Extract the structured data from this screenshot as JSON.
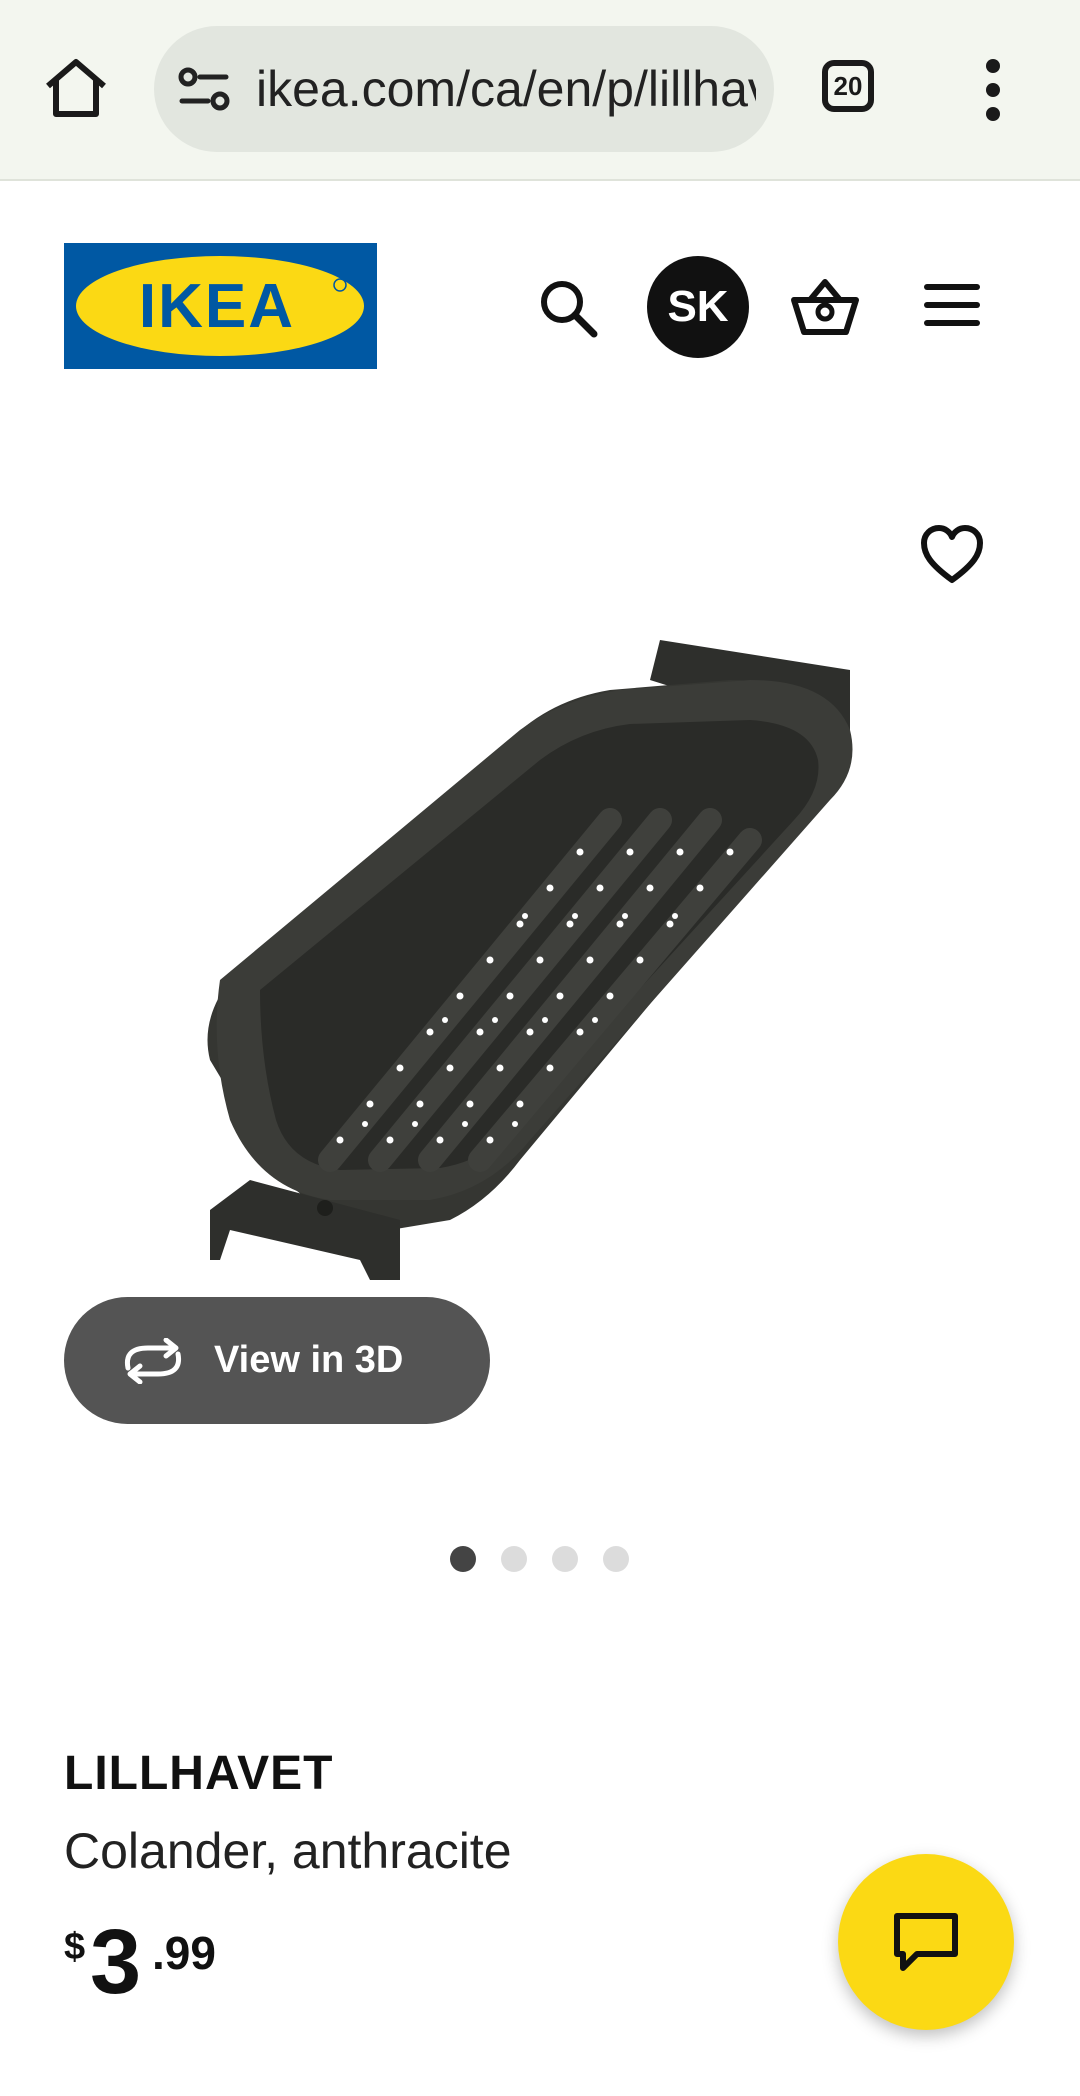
{
  "browser": {
    "url": "ikea.com/ca/en/p/lillhavet-colander-anthracite",
    "tab_count": "20",
    "icons": {
      "home": "home-icon",
      "site_info": "tune-icon",
      "menu": "more-vert-icon"
    }
  },
  "header": {
    "logo_text": "IKEA",
    "avatar_initials": "SK",
    "icons": {
      "search": "search-icon",
      "basket": "basket-icon",
      "menu": "hamburger-icon"
    }
  },
  "gallery": {
    "view_3d_label": "View in 3D",
    "image_count": 4,
    "active_index": 0
  },
  "product": {
    "name": "LILLHAVET",
    "description": "Colander, anthracite",
    "price": {
      "currency": "$",
      "integer": "3",
      "decimal": ".99"
    }
  },
  "colors": {
    "ikea_blue": "#0058a3",
    "ikea_yellow": "#fbd914",
    "chat_button": "#fbd914"
  }
}
